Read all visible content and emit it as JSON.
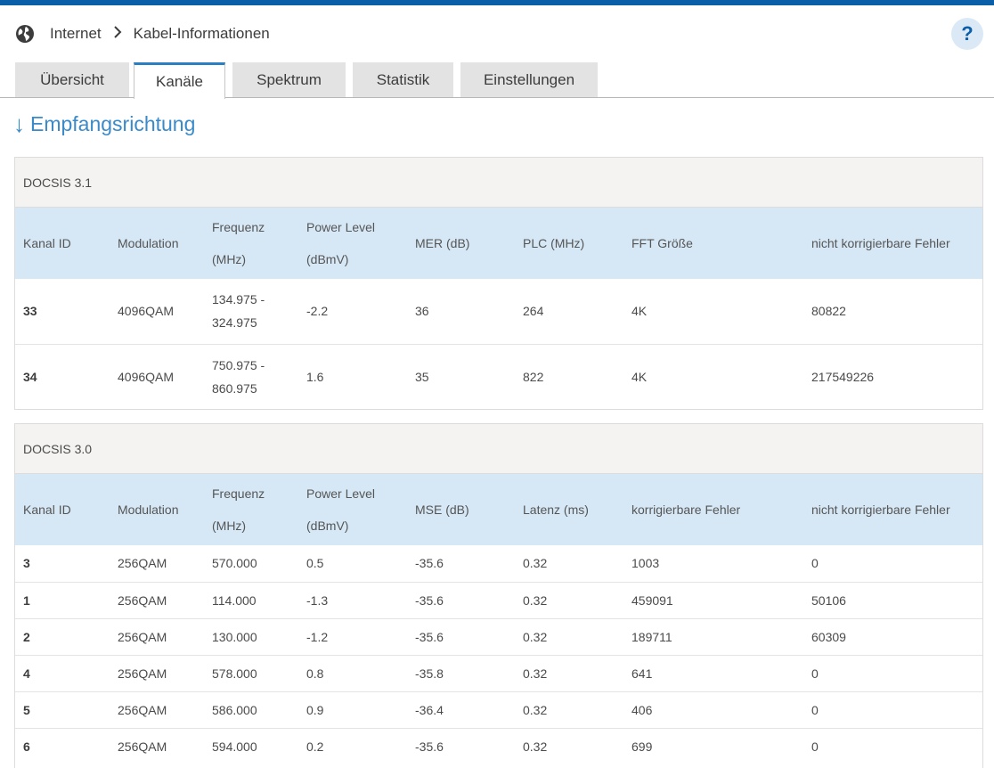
{
  "breadcrumb": {
    "root": "Internet",
    "separator": "›",
    "current": "Kabel-Informationen",
    "icon": "globe-icon"
  },
  "help": {
    "label": "?",
    "icon": "help-icon"
  },
  "tabs": [
    {
      "label": "Übersicht",
      "active": false
    },
    {
      "label": "Kanäle",
      "active": true
    },
    {
      "label": "Spektrum",
      "active": false
    },
    {
      "label": "Statistik",
      "active": false
    },
    {
      "label": "Einstellungen",
      "active": false
    }
  ],
  "section": {
    "arrow": "↓",
    "title": "Empfangsrichtung"
  },
  "docsis31": {
    "title": "DOCSIS 3.1",
    "headers": [
      "Kanal ID",
      "Modulation",
      "Frequenz (MHz)",
      "Power Level (dBmV)",
      "MER (dB)",
      "PLC (MHz)",
      "FFT Größe",
      "nicht korrigierbare Fehler"
    ],
    "rows": [
      [
        "33",
        "4096QAM",
        "134.975 - 324.975",
        "-2.2",
        "36",
        "264",
        "4K",
        "80822"
      ],
      [
        "34",
        "4096QAM",
        "750.975 - 860.975",
        "1.6",
        "35",
        "822",
        "4K",
        "217549226"
      ]
    ]
  },
  "docsis30": {
    "title": "DOCSIS 3.0",
    "headers": [
      "Kanal ID",
      "Modulation",
      "Frequenz (MHz)",
      "Power Level (dBmV)",
      "MSE (dB)",
      "Latenz (ms)",
      "korrigierbare Fehler",
      "nicht korrigierbare Fehler"
    ],
    "rows": [
      [
        "3",
        "256QAM",
        "570.000",
        "0.5",
        "-35.6",
        "0.32",
        "1003",
        "0"
      ],
      [
        "1",
        "256QAM",
        "114.000",
        "-1.3",
        "-35.6",
        "0.32",
        "459091",
        "50106"
      ],
      [
        "2",
        "256QAM",
        "130.000",
        "-1.2",
        "-35.6",
        "0.32",
        "189711",
        "60309"
      ],
      [
        "4",
        "256QAM",
        "578.000",
        "0.8",
        "-35.8",
        "0.32",
        "641",
        "0"
      ],
      [
        "5",
        "256QAM",
        "586.000",
        "0.9",
        "-36.4",
        "0.32",
        "406",
        "0"
      ],
      [
        "6",
        "256QAM",
        "594.000",
        "0.2",
        "-35.6",
        "0.32",
        "699",
        "0"
      ]
    ]
  },
  "colors": {
    "accent": "#0b5ea8",
    "tab_active_border": "#2a7ec4",
    "section_title": "#3a8ac9",
    "table_header_bg": "#d6e8f6",
    "panel_head_bg": "#f4f3f2"
  }
}
